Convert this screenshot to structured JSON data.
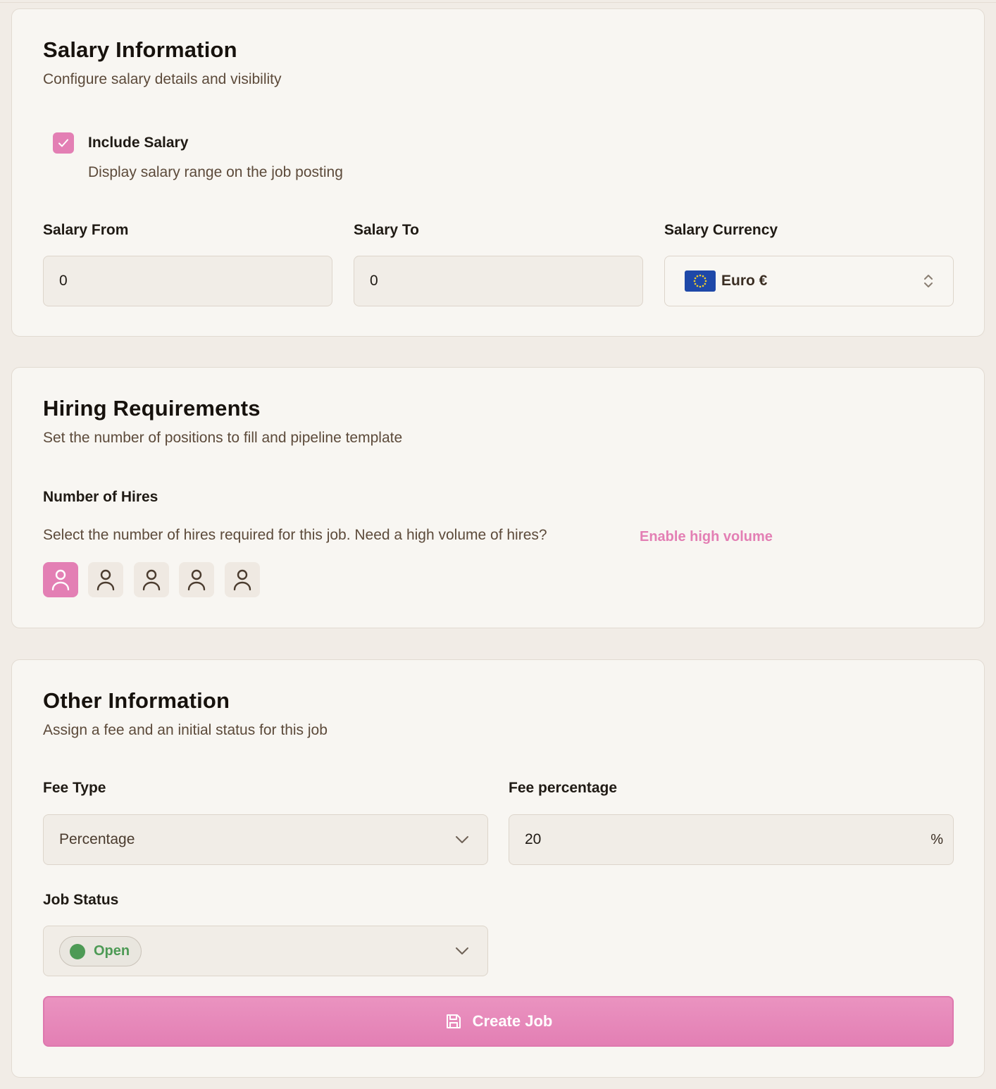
{
  "salary": {
    "title": "Salary Information",
    "subtitle": "Configure salary details and visibility",
    "include_label": "Include Salary",
    "include_description": "Display salary range on the job posting",
    "include_checked": true,
    "from_label": "Salary From",
    "from_value": "0",
    "to_label": "Salary To",
    "to_value": "0",
    "currency_label": "Salary Currency",
    "currency_value": "Euro €",
    "currency_icon": "eu-flag-icon"
  },
  "hiring": {
    "title": "Hiring Requirements",
    "subtitle": "Set the number of positions to fill and pipeline template",
    "hires_label": "Number of Hires",
    "hires_description": "Select the number of hires required for this job. Need a high volume of hires?",
    "high_volume_link": "Enable high volume",
    "hires_selected": 1,
    "hires_options": 5
  },
  "other": {
    "title": "Other Information",
    "subtitle": "Assign a fee and an initial status for this job",
    "fee_type_label": "Fee Type",
    "fee_type_value": "Percentage",
    "fee_percentage_label": "Fee percentage",
    "fee_percentage_value": "20",
    "fee_percentage_suffix": "%",
    "job_status_label": "Job Status",
    "job_status_value": "Open",
    "job_status_color": "#4d9a55"
  },
  "actions": {
    "create_label": "Create Job",
    "create_icon": "save-icon"
  },
  "colors": {
    "accent": "#e37fb4",
    "background": "#f1ece6",
    "card": "#f8f6f2"
  }
}
